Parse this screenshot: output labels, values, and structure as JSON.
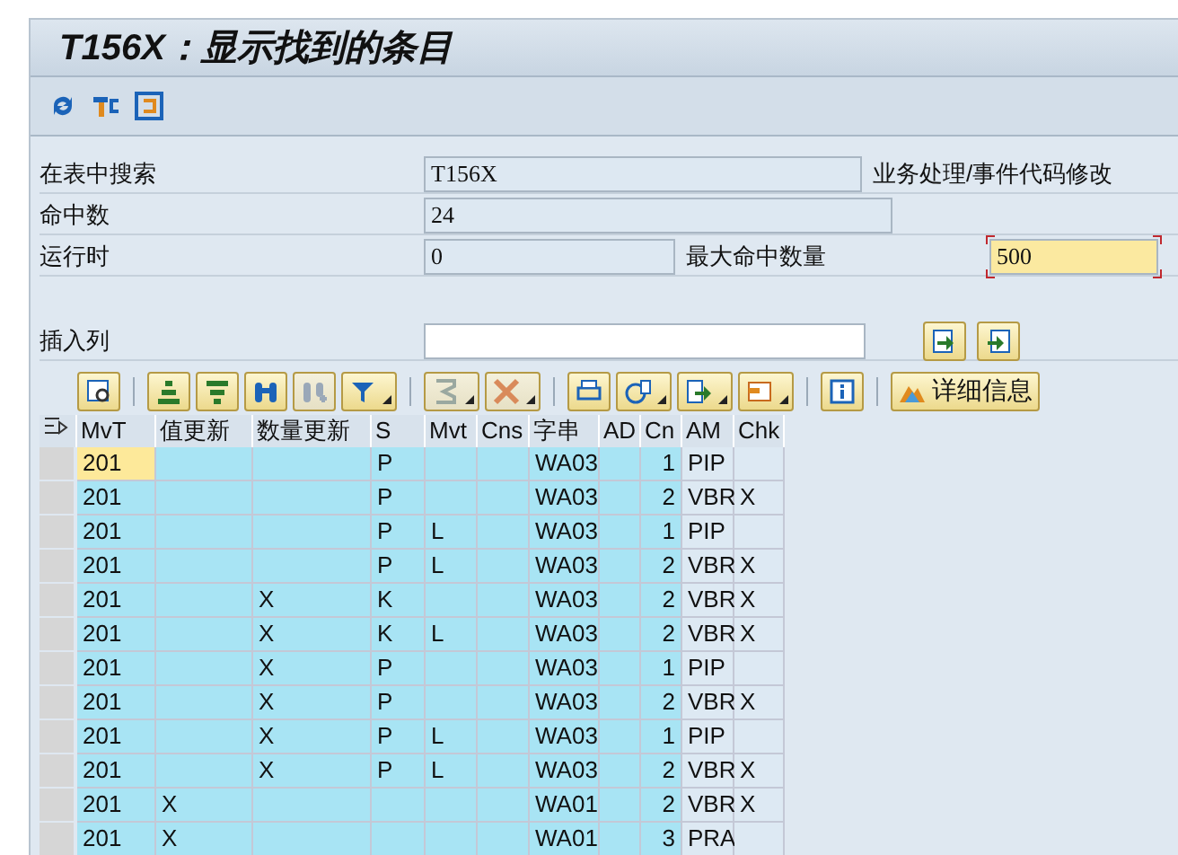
{
  "window": {
    "title": "T156X：显示找到的条目"
  },
  "toolbar": {
    "buttons": [
      {
        "kind": "refresh"
      },
      {
        "kind": "settings"
      },
      {
        "kind": "exit"
      }
    ]
  },
  "form": {
    "rows": [
      {
        "label": "在表中搜索",
        "value": "T156X",
        "note": "业务处理/事件代码修改"
      },
      {
        "label": "命中数",
        "value": "24"
      },
      {
        "label": "运行时",
        "value": "0",
        "extra_label": "最大命中数量",
        "extra_value": "500",
        "extra_focused": true
      }
    ],
    "insert": {
      "label": "插入列",
      "buttons": [
        {
          "kind": "insert-before"
        },
        {
          "kind": "insert-after"
        }
      ]
    }
  },
  "grid_toolbar": {
    "buttons": [
      {
        "kind": "details",
        "disabled": false,
        "menu": false,
        "sep": false
      },
      {
        "kind": "sort-asc",
        "disabled": false,
        "menu": false,
        "sep": true
      },
      {
        "kind": "sort-desc",
        "disabled": false,
        "menu": false,
        "sep": false
      },
      {
        "kind": "find",
        "disabled": false,
        "menu": false,
        "sep": false
      },
      {
        "kind": "find-next",
        "disabled": true,
        "menu": false,
        "sep": false
      },
      {
        "kind": "filter",
        "disabled": false,
        "menu": true,
        "sep": false
      },
      {
        "kind": "sum",
        "disabled": true,
        "menu": true,
        "sep": true
      },
      {
        "kind": "subtotal",
        "disabled": true,
        "menu": true,
        "sep": false
      },
      {
        "kind": "print",
        "disabled": false,
        "menu": false,
        "sep": true
      },
      {
        "kind": "views",
        "disabled": false,
        "menu": true,
        "sep": false
      },
      {
        "kind": "export",
        "disabled": false,
        "menu": true,
        "sep": false
      },
      {
        "kind": "layout",
        "disabled": false,
        "menu": true,
        "sep": false
      },
      {
        "kind": "info",
        "disabled": false,
        "menu": false,
        "sep": true
      },
      {
        "kind": "detail-text",
        "label": "详细信息",
        "disabled": false,
        "menu": false,
        "sep": true
      }
    ]
  },
  "table": {
    "columns": [
      {
        "label": "MvT",
        "key": true,
        "kind": "text"
      },
      {
        "label": "值更新",
        "key": true,
        "kind": "text"
      },
      {
        "label": "数量更新",
        "key": true,
        "kind": "text"
      },
      {
        "label": "S",
        "key": true,
        "kind": "text"
      },
      {
        "label": "Mvt",
        "key": true,
        "kind": "text"
      },
      {
        "label": "Cns",
        "key": true,
        "kind": "text"
      },
      {
        "label": "字串",
        "key": true,
        "kind": "text"
      },
      {
        "label": "AD",
        "key": true,
        "kind": "text"
      },
      {
        "label": "Cn",
        "key": true,
        "kind": "number"
      },
      {
        "label": "AM",
        "key": false,
        "kind": "text"
      },
      {
        "label": "Chk",
        "key": false,
        "kind": "text"
      }
    ],
    "rows": [
      {
        "focused": true,
        "cells": [
          "201",
          null,
          null,
          "P",
          null,
          null,
          "WA03",
          null,
          "1",
          "PIP",
          null
        ]
      },
      {
        "focused": false,
        "cells": [
          "201",
          null,
          null,
          "P",
          null,
          null,
          "WA03",
          null,
          "2",
          "VBR",
          "X"
        ]
      },
      {
        "focused": false,
        "cells": [
          "201",
          null,
          null,
          "P",
          "L",
          null,
          "WA03",
          null,
          "1",
          "PIP",
          null
        ]
      },
      {
        "focused": false,
        "cells": [
          "201",
          null,
          null,
          "P",
          "L",
          null,
          "WA03",
          null,
          "2",
          "VBR",
          "X"
        ]
      },
      {
        "focused": false,
        "cells": [
          "201",
          null,
          "X",
          "K",
          null,
          null,
          "WA03",
          null,
          "2",
          "VBR",
          "X"
        ]
      },
      {
        "focused": false,
        "cells": [
          "201",
          null,
          "X",
          "K",
          "L",
          null,
          "WA03",
          null,
          "2",
          "VBR",
          "X"
        ]
      },
      {
        "focused": false,
        "cells": [
          "201",
          null,
          "X",
          "P",
          null,
          null,
          "WA03",
          null,
          "1",
          "PIP",
          null
        ]
      },
      {
        "focused": false,
        "cells": [
          "201",
          null,
          "X",
          "P",
          null,
          null,
          "WA03",
          null,
          "2",
          "VBR",
          "X"
        ]
      },
      {
        "focused": false,
        "cells": [
          "201",
          null,
          "X",
          "P",
          "L",
          null,
          "WA03",
          null,
          "1",
          "PIP",
          null
        ]
      },
      {
        "focused": false,
        "cells": [
          "201",
          null,
          "X",
          "P",
          "L",
          null,
          "WA03",
          null,
          "2",
          "VBR",
          "X"
        ]
      },
      {
        "focused": false,
        "cells": [
          "201",
          "X",
          null,
          null,
          null,
          null,
          "WA01",
          null,
          "2",
          "VBR",
          "X"
        ]
      },
      {
        "focused": false,
        "cells": [
          "201",
          "X",
          null,
          null,
          null,
          null,
          "WA01",
          null,
          "3",
          "PRA",
          null
        ]
      }
    ]
  }
}
